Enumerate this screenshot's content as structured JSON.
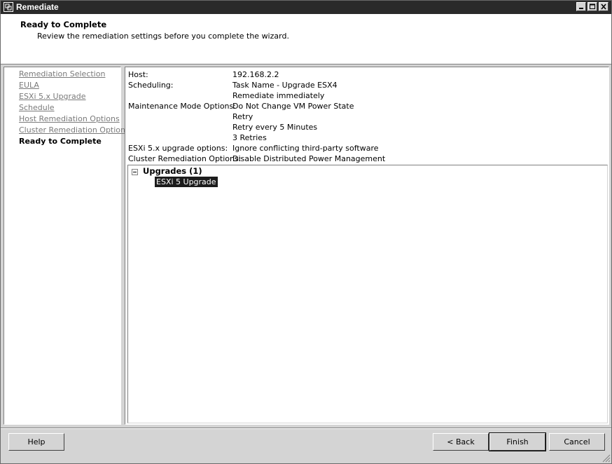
{
  "window": {
    "title": "Remediate"
  },
  "header": {
    "title": "Ready to Complete",
    "subtitle": "Review the remediation settings before you complete the wizard."
  },
  "nav": {
    "items": [
      {
        "label": "Remediation Selection",
        "current": false
      },
      {
        "label": "EULA",
        "current": false
      },
      {
        "label": "ESXi 5.x Upgrade",
        "current": false
      },
      {
        "label": "Schedule",
        "current": false
      },
      {
        "label": "Host Remediation Options",
        "current": false
      },
      {
        "label": "Cluster Remediation Options",
        "current": false
      },
      {
        "label": "Ready to Complete",
        "current": true
      }
    ]
  },
  "summary": {
    "host_label": "Host:",
    "host_value": "192.168.2.2",
    "scheduling_label": "Scheduling:",
    "scheduling_values": [
      "Task Name - Upgrade ESX4",
      "Remediate immediately"
    ],
    "maintenance_label": "Maintenance Mode Options:",
    "maintenance_values": [
      "Do Not Change VM Power State",
      "Retry",
      "Retry every 5 Minutes",
      "3 Retries"
    ],
    "esxi_label": "ESXi 5.x upgrade options:",
    "esxi_value": "Ignore conflicting third-party software",
    "cluster_label": "Cluster Remediation Options:",
    "cluster_value": "Disable Distributed Power Management"
  },
  "upgrades": {
    "group_label": "Upgrades (1)",
    "items": [
      "ESXi 5 Upgrade"
    ]
  },
  "buttons": {
    "help": "Help",
    "back": "< Back",
    "finish": "Finish",
    "cancel": "Cancel"
  }
}
